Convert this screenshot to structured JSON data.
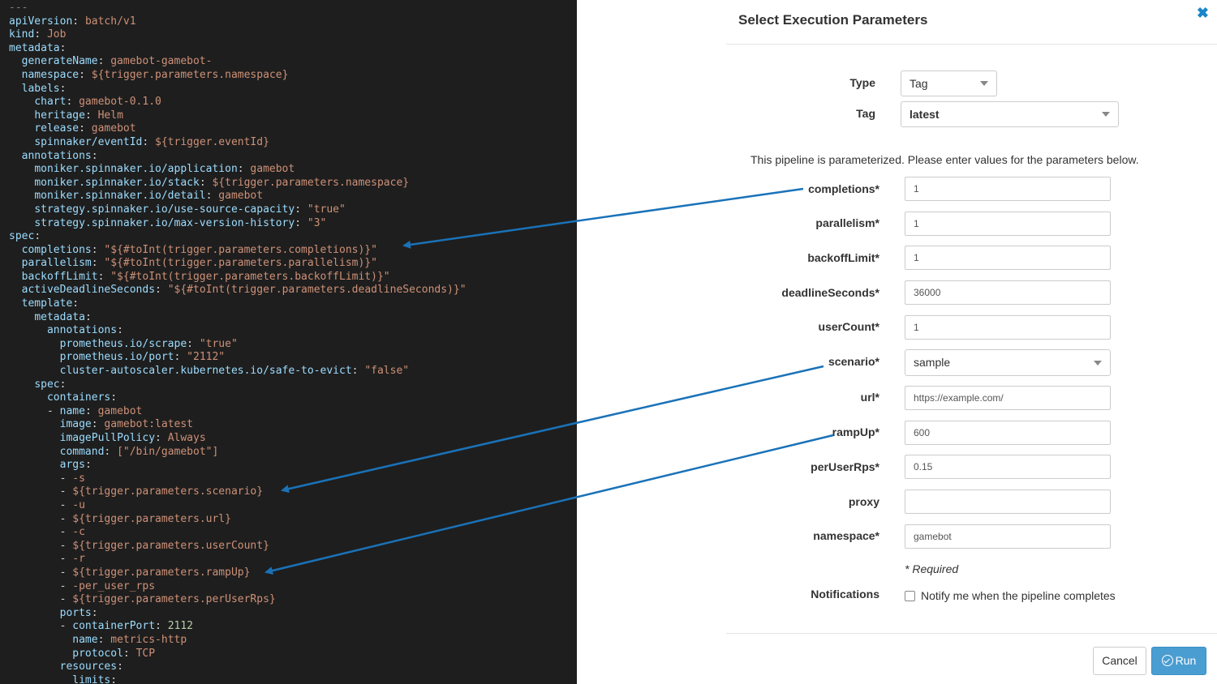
{
  "code": {
    "lines": [
      [
        [
          "c",
          "---"
        ]
      ],
      [
        [
          "k",
          "apiVersion"
        ],
        [
          "p",
          ": "
        ],
        [
          "v",
          "batch/v1"
        ]
      ],
      [
        [
          "k",
          "kind"
        ],
        [
          "p",
          ": "
        ],
        [
          "v",
          "Job"
        ]
      ],
      [
        [
          "k",
          "metadata"
        ],
        [
          "p",
          ":"
        ]
      ],
      [
        [
          "p",
          "  "
        ],
        [
          "k",
          "generateName"
        ],
        [
          "p",
          ": "
        ],
        [
          "v",
          "gamebot-gamebot-"
        ]
      ],
      [
        [
          "p",
          "  "
        ],
        [
          "k",
          "namespace"
        ],
        [
          "p",
          ": "
        ],
        [
          "v",
          "${trigger.parameters.namespace}"
        ]
      ],
      [
        [
          "p",
          "  "
        ],
        [
          "k",
          "labels"
        ],
        [
          "p",
          ":"
        ]
      ],
      [
        [
          "p",
          "    "
        ],
        [
          "k",
          "chart"
        ],
        [
          "p",
          ": "
        ],
        [
          "v",
          "gamebot-0.1.0"
        ]
      ],
      [
        [
          "p",
          "    "
        ],
        [
          "k",
          "heritage"
        ],
        [
          "p",
          ": "
        ],
        [
          "v",
          "Helm"
        ]
      ],
      [
        [
          "p",
          "    "
        ],
        [
          "k",
          "release"
        ],
        [
          "p",
          ": "
        ],
        [
          "v",
          "gamebot"
        ]
      ],
      [
        [
          "p",
          "    "
        ],
        [
          "k",
          "spinnaker/eventId"
        ],
        [
          "p",
          ": "
        ],
        [
          "v",
          "${trigger.eventId}"
        ]
      ],
      [
        [
          "p",
          "  "
        ],
        [
          "k",
          "annotations"
        ],
        [
          "p",
          ":"
        ]
      ],
      [
        [
          "p",
          "    "
        ],
        [
          "k",
          "moniker.spinnaker.io/application"
        ],
        [
          "p",
          ": "
        ],
        [
          "v",
          "gamebot"
        ]
      ],
      [
        [
          "p",
          "    "
        ],
        [
          "k",
          "moniker.spinnaker.io/stack"
        ],
        [
          "p",
          ": "
        ],
        [
          "v",
          "${trigger.parameters.namespace}"
        ]
      ],
      [
        [
          "p",
          "    "
        ],
        [
          "k",
          "moniker.spinnaker.io/detail"
        ],
        [
          "p",
          ": "
        ],
        [
          "v",
          "gamebot"
        ]
      ],
      [
        [
          "p",
          "    "
        ],
        [
          "k",
          "strategy.spinnaker.io/use-source-capacity"
        ],
        [
          "p",
          ": "
        ],
        [
          "v",
          "\"true\""
        ]
      ],
      [
        [
          "p",
          "    "
        ],
        [
          "k",
          "strategy.spinnaker.io/max-version-history"
        ],
        [
          "p",
          ": "
        ],
        [
          "v",
          "\"3\""
        ]
      ],
      [
        [
          "k",
          "spec"
        ],
        [
          "p",
          ":"
        ]
      ],
      [
        [
          "p",
          "  "
        ],
        [
          "k",
          "completions"
        ],
        [
          "p",
          ": "
        ],
        [
          "v",
          "\"${#toInt(trigger.parameters.completions)}\""
        ]
      ],
      [
        [
          "p",
          "  "
        ],
        [
          "k",
          "parallelism"
        ],
        [
          "p",
          ": "
        ],
        [
          "v",
          "\"${#toInt(trigger.parameters.parallelism)}\""
        ]
      ],
      [
        [
          "p",
          "  "
        ],
        [
          "k",
          "backoffLimit"
        ],
        [
          "p",
          ": "
        ],
        [
          "v",
          "\"${#toInt(trigger.parameters.backoffLimit)}\""
        ]
      ],
      [
        [
          "p",
          "  "
        ],
        [
          "k",
          "activeDeadlineSeconds"
        ],
        [
          "p",
          ": "
        ],
        [
          "v",
          "\"${#toInt(trigger.parameters.deadlineSeconds)}\""
        ]
      ],
      [
        [
          "p",
          "  "
        ],
        [
          "k",
          "template"
        ],
        [
          "p",
          ":"
        ]
      ],
      [
        [
          "p",
          "    "
        ],
        [
          "k",
          "metadata"
        ],
        [
          "p",
          ":"
        ]
      ],
      [
        [
          "p",
          "      "
        ],
        [
          "k",
          "annotations"
        ],
        [
          "p",
          ":"
        ]
      ],
      [
        [
          "p",
          "        "
        ],
        [
          "k",
          "prometheus.io/scrape"
        ],
        [
          "p",
          ": "
        ],
        [
          "v",
          "\"true\""
        ]
      ],
      [
        [
          "p",
          "        "
        ],
        [
          "k",
          "prometheus.io/port"
        ],
        [
          "p",
          ": "
        ],
        [
          "v",
          "\"2112\""
        ]
      ],
      [
        [
          "p",
          "        "
        ],
        [
          "k",
          "cluster-autoscaler.kubernetes.io/safe-to-evict"
        ],
        [
          "p",
          ": "
        ],
        [
          "v",
          "\"false\""
        ]
      ],
      [
        [
          "p",
          "    "
        ],
        [
          "k",
          "spec"
        ],
        [
          "p",
          ":"
        ]
      ],
      [
        [
          "p",
          "      "
        ],
        [
          "k",
          "containers"
        ],
        [
          "p",
          ":"
        ]
      ],
      [
        [
          "p",
          "      "
        ],
        [
          "p",
          "- "
        ],
        [
          "k",
          "name"
        ],
        [
          "p",
          ": "
        ],
        [
          "v",
          "gamebot"
        ]
      ],
      [
        [
          "p",
          "        "
        ],
        [
          "k",
          "image"
        ],
        [
          "p",
          ": "
        ],
        [
          "v",
          "gamebot:latest"
        ]
      ],
      [
        [
          "p",
          "        "
        ],
        [
          "k",
          "imagePullPolicy"
        ],
        [
          "p",
          ": "
        ],
        [
          "v",
          "Always"
        ]
      ],
      [
        [
          "p",
          "        "
        ],
        [
          "k",
          "command"
        ],
        [
          "p",
          ": "
        ],
        [
          "v",
          "[\"/bin/gamebot\"]"
        ]
      ],
      [
        [
          "p",
          "        "
        ],
        [
          "k",
          "args"
        ],
        [
          "p",
          ":"
        ]
      ],
      [
        [
          "p",
          "        "
        ],
        [
          "p",
          "- "
        ],
        [
          "v",
          "-s"
        ]
      ],
      [
        [
          "p",
          "        "
        ],
        [
          "p",
          "- "
        ],
        [
          "v",
          "${trigger.parameters.scenario}"
        ]
      ],
      [
        [
          "p",
          "        "
        ],
        [
          "p",
          "- "
        ],
        [
          "v",
          "-u"
        ]
      ],
      [
        [
          "p",
          "        "
        ],
        [
          "p",
          "- "
        ],
        [
          "v",
          "${trigger.parameters.url}"
        ]
      ],
      [
        [
          "p",
          "        "
        ],
        [
          "p",
          "- "
        ],
        [
          "v",
          "-c"
        ]
      ],
      [
        [
          "p",
          "        "
        ],
        [
          "p",
          "- "
        ],
        [
          "v",
          "${trigger.parameters.userCount}"
        ]
      ],
      [
        [
          "p",
          "        "
        ],
        [
          "p",
          "- "
        ],
        [
          "v",
          "-r"
        ]
      ],
      [
        [
          "p",
          "        "
        ],
        [
          "p",
          "- "
        ],
        [
          "v",
          "${trigger.parameters.rampUp}"
        ]
      ],
      [
        [
          "p",
          "        "
        ],
        [
          "p",
          "- "
        ],
        [
          "v",
          "-per_user_rps"
        ]
      ],
      [
        [
          "p",
          "        "
        ],
        [
          "p",
          "- "
        ],
        [
          "v",
          "${trigger.parameters.perUserRps}"
        ]
      ],
      [
        [
          "p",
          "        "
        ],
        [
          "k",
          "ports"
        ],
        [
          "p",
          ":"
        ]
      ],
      [
        [
          "p",
          "        "
        ],
        [
          "p",
          "- "
        ],
        [
          "k",
          "containerPort"
        ],
        [
          "p",
          ": "
        ],
        [
          "n",
          "2112"
        ]
      ],
      [
        [
          "p",
          "          "
        ],
        [
          "k",
          "name"
        ],
        [
          "p",
          ": "
        ],
        [
          "v",
          "metrics-http"
        ]
      ],
      [
        [
          "p",
          "          "
        ],
        [
          "k",
          "protocol"
        ],
        [
          "p",
          ": "
        ],
        [
          "v",
          "TCP"
        ]
      ],
      [
        [
          "p",
          "        "
        ],
        [
          "k",
          "resources"
        ],
        [
          "p",
          ":"
        ]
      ],
      [
        [
          "p",
          "          "
        ],
        [
          "k",
          "limits"
        ],
        [
          "p",
          ":"
        ]
      ]
    ]
  },
  "modal": {
    "title": "Select Execution Parameters",
    "close_glyph": "✖",
    "type": {
      "label": "Type",
      "value": "Tag"
    },
    "tag": {
      "label": "Tag",
      "value": "latest"
    },
    "intro": "This pipeline is parameterized. Please enter values for the parameters below.",
    "params": [
      {
        "label": "completions*",
        "value": "1"
      },
      {
        "label": "parallelism*",
        "value": "1"
      },
      {
        "label": "backoffLimit*",
        "value": "1"
      },
      {
        "label": "deadlineSeconds*",
        "value": "36000"
      },
      {
        "label": "userCount*",
        "value": "1"
      },
      {
        "label": "scenario*",
        "value": "sample"
      },
      {
        "label": "url*",
        "value": "https://example.com/"
      },
      {
        "label": "rampUp*",
        "value": "600"
      },
      {
        "label": "perUserRps*",
        "value": "0.15"
      },
      {
        "label": "proxy",
        "value": ""
      },
      {
        "label": "namespace*",
        "value": "gamebot"
      }
    ],
    "required_note": "* Required",
    "notifications": {
      "label": "Notifications",
      "checkbox_label": "Notify me when the pipeline completes",
      "checked": false
    },
    "footer": {
      "cancel_label": "Cancel",
      "run_label": "Run"
    }
  },
  "colors": {
    "arrow": "#1a72b8",
    "run_button": "#4a9dd1",
    "code_background": "#1e1e1e"
  }
}
